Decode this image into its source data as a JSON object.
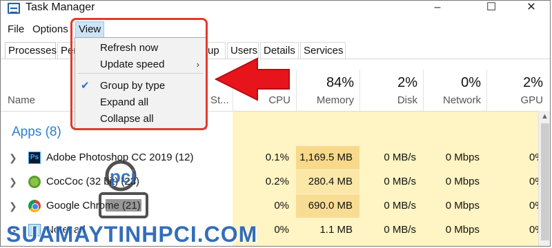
{
  "window": {
    "title": "Task Manager",
    "controls": [
      "–",
      "☐",
      "✕"
    ]
  },
  "menubar": {
    "items": [
      "File",
      "Options",
      "View"
    ],
    "active": "View"
  },
  "tabs": [
    "Processes",
    "Per",
    "up",
    "Users",
    "Details",
    "Services"
  ],
  "view_menu": {
    "items": [
      {
        "label": "Refresh now",
        "checked": false,
        "submenu": false
      },
      {
        "label": "Update speed",
        "checked": false,
        "submenu": true
      },
      {
        "label": "Group by type",
        "checked": true,
        "submenu": false
      },
      {
        "label": "Expand all",
        "checked": false,
        "submenu": false
      },
      {
        "label": "Collapse all",
        "checked": false,
        "submenu": false
      }
    ],
    "submenu_arrow": "›",
    "check_mark": "✔"
  },
  "columns": {
    "name": "Name",
    "status": "St...",
    "cpu": {
      "percent": "",
      "label": "CPU"
    },
    "memory": {
      "percent": "84%",
      "label": "Memory"
    },
    "disk": {
      "percent": "2%",
      "label": "Disk"
    },
    "network": {
      "percent": "0%",
      "label": "Network"
    },
    "gpu": {
      "percent": "2%",
      "label": "GPU"
    }
  },
  "apps_section": {
    "title": "Apps (8)"
  },
  "processes": [
    {
      "name": "Adobe Photoshop CC 2019 (12)",
      "icon": "photoshop-icon",
      "icon_text": "Ps",
      "cpu": "0.1%",
      "memory": "1,169.5 MB",
      "disk": "0 MB/s",
      "network": "0 Mbps",
      "gpu": "0%"
    },
    {
      "name": "CocCoc (32 bit) (23)",
      "icon": "coccoc-icon",
      "icon_text": "",
      "cpu": "0.2%",
      "memory": "280.4 MB",
      "disk": "0 MB/s",
      "network": "0 Mbps",
      "gpu": "0%"
    },
    {
      "name": "Google Chrome (21)",
      "icon": "chrome-icon",
      "icon_text": "",
      "cpu": "0%",
      "memory": "690.0 MB",
      "disk": "0 MB/s",
      "network": "0 Mbps",
      "gpu": "0%"
    },
    {
      "name": "Notepad",
      "icon": "notepad-icon",
      "icon_text": "",
      "cpu": "0%",
      "memory": "1.1 MB",
      "disk": "0 MB/s",
      "network": "0 Mbps",
      "gpu": "0%"
    }
  ],
  "colors": {
    "cpu_cell": "#fff4c4",
    "memory_high": "#f8d88a",
    "memory_med": "#fbe7a8",
    "memory_low": "#fff4c4",
    "accent_blue": "#2a7fd4",
    "annotation_red": "#e23a2a"
  },
  "watermark": {
    "logo_text": "pci",
    "text": "SUAMAYTINHPCI.COM"
  }
}
